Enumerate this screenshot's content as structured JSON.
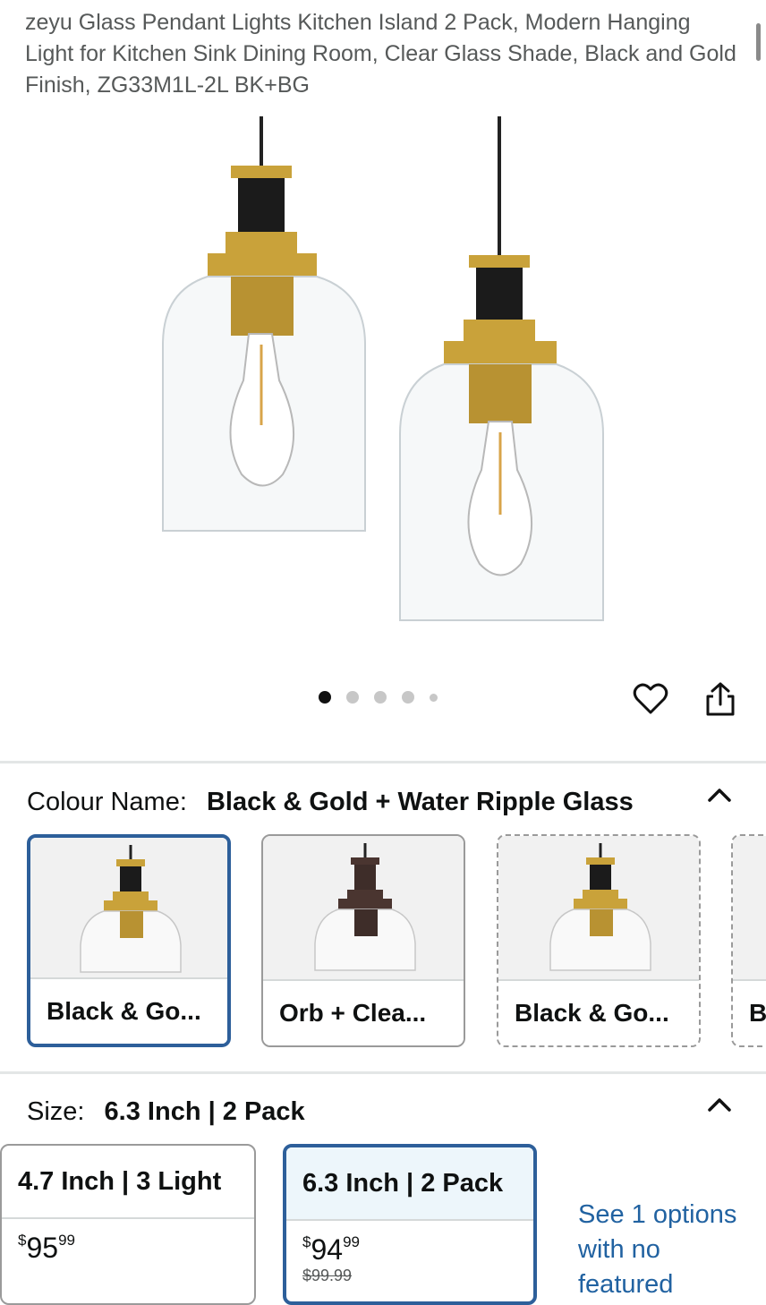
{
  "product": {
    "title": "zeyu Glass Pendant Lights Kitchen Island 2 Pack, Modern Hanging Light for Kitchen Sink Dining Room, Clear Glass Shade, Black and Gold Finish, ZG33M1L-2L BK+BG"
  },
  "gallery": {
    "image_count": 5,
    "active_index": 0,
    "icons": [
      "heart-icon",
      "share-icon"
    ]
  },
  "colour": {
    "label": "Colour Name:",
    "selected": "Black & Gold + Water Ripple Glass",
    "options": [
      {
        "label": "Black & Go...",
        "state": "selected"
      },
      {
        "label": "Orb + Clea...",
        "state": "available"
      },
      {
        "label": "Black & Go...",
        "state": "dashed"
      },
      {
        "label": "B",
        "state": "dashed"
      }
    ]
  },
  "size": {
    "label": "Size:",
    "selected": "6.3 Inch | 2 Pack",
    "options": [
      {
        "label": "4.7 Inch | 3 Light",
        "currency": "$",
        "whole": "95",
        "cents": "99",
        "was": ""
      },
      {
        "label": "6.3 Inch | 2 Pack",
        "currency": "$",
        "whole": "94",
        "cents": "99",
        "was": "$99.99"
      }
    ],
    "see_more": "See 1 options with no featured"
  },
  "colors": {
    "accent": "#2d5f9a",
    "link": "#2162a1",
    "gold": "#c9a23a",
    "black": "#1b1b1b",
    "orb": "#4a3530"
  }
}
